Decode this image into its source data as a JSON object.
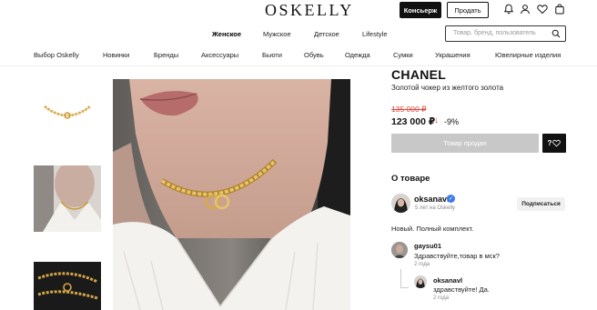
{
  "header": {
    "logo": "OSKELLY",
    "concierge_label": "Консьерж",
    "sell_label": "Продать",
    "icons": [
      "bell-icon",
      "user-icon",
      "heart-icon",
      "bag-icon"
    ]
  },
  "gender_nav": {
    "items": [
      {
        "label": "Женское",
        "active": true
      },
      {
        "label": "Мужское",
        "active": false
      },
      {
        "label": "Детское",
        "active": false
      },
      {
        "label": "Lifestyle",
        "active": false
      }
    ]
  },
  "search": {
    "placeholder": "Товар, бренд, пользователь"
  },
  "categories": {
    "items": [
      "Выбор Oskelly",
      "Новинки",
      "Бренды",
      "Аксессуары",
      "Бьюти",
      "Обувь",
      "Одежда",
      "Сумки",
      "Украшения",
      "Ювелирные изделия"
    ]
  },
  "product": {
    "brand": "CHANEL",
    "name": "Золотой чокер из желтого золота",
    "old_price": "135 000 ₽",
    "new_price": "123 000 ₽",
    "discount_arrow": "↓",
    "discount": "-9%",
    "sold_label": "Товар продан",
    "fav_prefix": "?"
  },
  "about": {
    "title": "О товаре",
    "seller": {
      "name": "oksanavl",
      "verified_mark": "✓",
      "subtitle": "5 лет на Oskelly",
      "follow_label": "Подписаться"
    },
    "description": "Новый. Полный комплект."
  },
  "comments": [
    {
      "author": "gaysu01",
      "text": "Здравствуйте,товар в мск?",
      "time": "2 года"
    },
    {
      "author": "oksanavl",
      "text": "здравствуйте! Да.",
      "time": "2 года",
      "is_reply": true
    }
  ],
  "colors": {
    "accent": "#111111",
    "price_old": "#e0463d",
    "sold_button": "#c8c8c8",
    "verified": "#3e7be8"
  }
}
